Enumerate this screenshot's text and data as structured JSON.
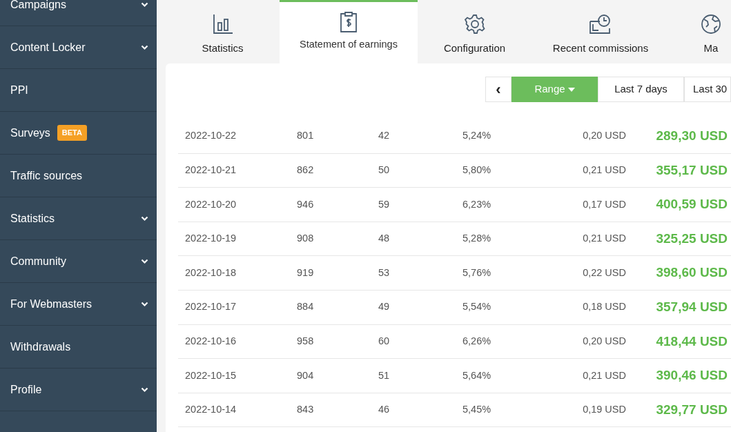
{
  "sidebar": {
    "items": [
      {
        "label": "Campaigns",
        "expandable": true
      },
      {
        "label": "Content Locker",
        "expandable": true
      },
      {
        "label": "PPI",
        "expandable": false
      },
      {
        "label": "Surveys",
        "expandable": false,
        "badge": "BETA"
      },
      {
        "label": "Traffic sources",
        "expandable": false
      },
      {
        "label": "Statistics",
        "expandable": true
      },
      {
        "label": "Community",
        "expandable": true
      },
      {
        "label": "For Webmasters",
        "expandable": true
      },
      {
        "label": "Withdrawals",
        "expandable": false
      },
      {
        "label": "Profile",
        "expandable": true
      }
    ]
  },
  "tabs": [
    {
      "label": "Statistics",
      "selected": false
    },
    {
      "label": "Statement of earnings",
      "selected": true
    },
    {
      "label": "Configuration",
      "selected": false
    },
    {
      "label": "Recent commissions",
      "selected": false
    },
    {
      "label": "Ma",
      "selected": false
    }
  ],
  "range_bar": {
    "prev": "‹",
    "buttons": [
      {
        "label": "Range",
        "selected": true,
        "dropdown": true
      },
      {
        "label": "Last 7 days",
        "selected": false,
        "dropdown": false
      },
      {
        "label": "Last 30",
        "selected": false,
        "dropdown": false
      }
    ]
  },
  "table": {
    "rows": [
      [
        "2022-10-22",
        "801",
        "42",
        "5,24%",
        "0,20 USD",
        "289,30 USD"
      ],
      [
        "2022-10-21",
        "862",
        "50",
        "5,80%",
        "0,21 USD",
        "355,17 USD"
      ],
      [
        "2022-10-20",
        "946",
        "59",
        "6,23%",
        "0,17 USD",
        "400,59 USD"
      ],
      [
        "2022-10-19",
        "908",
        "48",
        "5,28%",
        "0,21 USD",
        "325,25 USD"
      ],
      [
        "2022-10-18",
        "919",
        "53",
        "5,76%",
        "0,22 USD",
        "398,60 USD"
      ],
      [
        "2022-10-17",
        "884",
        "49",
        "5,54%",
        "0,18 USD",
        "357,94 USD"
      ],
      [
        "2022-10-16",
        "958",
        "60",
        "6,26%",
        "0,20 USD",
        "418,44 USD"
      ],
      [
        "2022-10-15",
        "904",
        "51",
        "5,64%",
        "0,21 USD",
        "390,46 USD"
      ],
      [
        "2022-10-14",
        "843",
        "46",
        "5,45%",
        "0,19 USD",
        "329,77 USD"
      ]
    ]
  }
}
